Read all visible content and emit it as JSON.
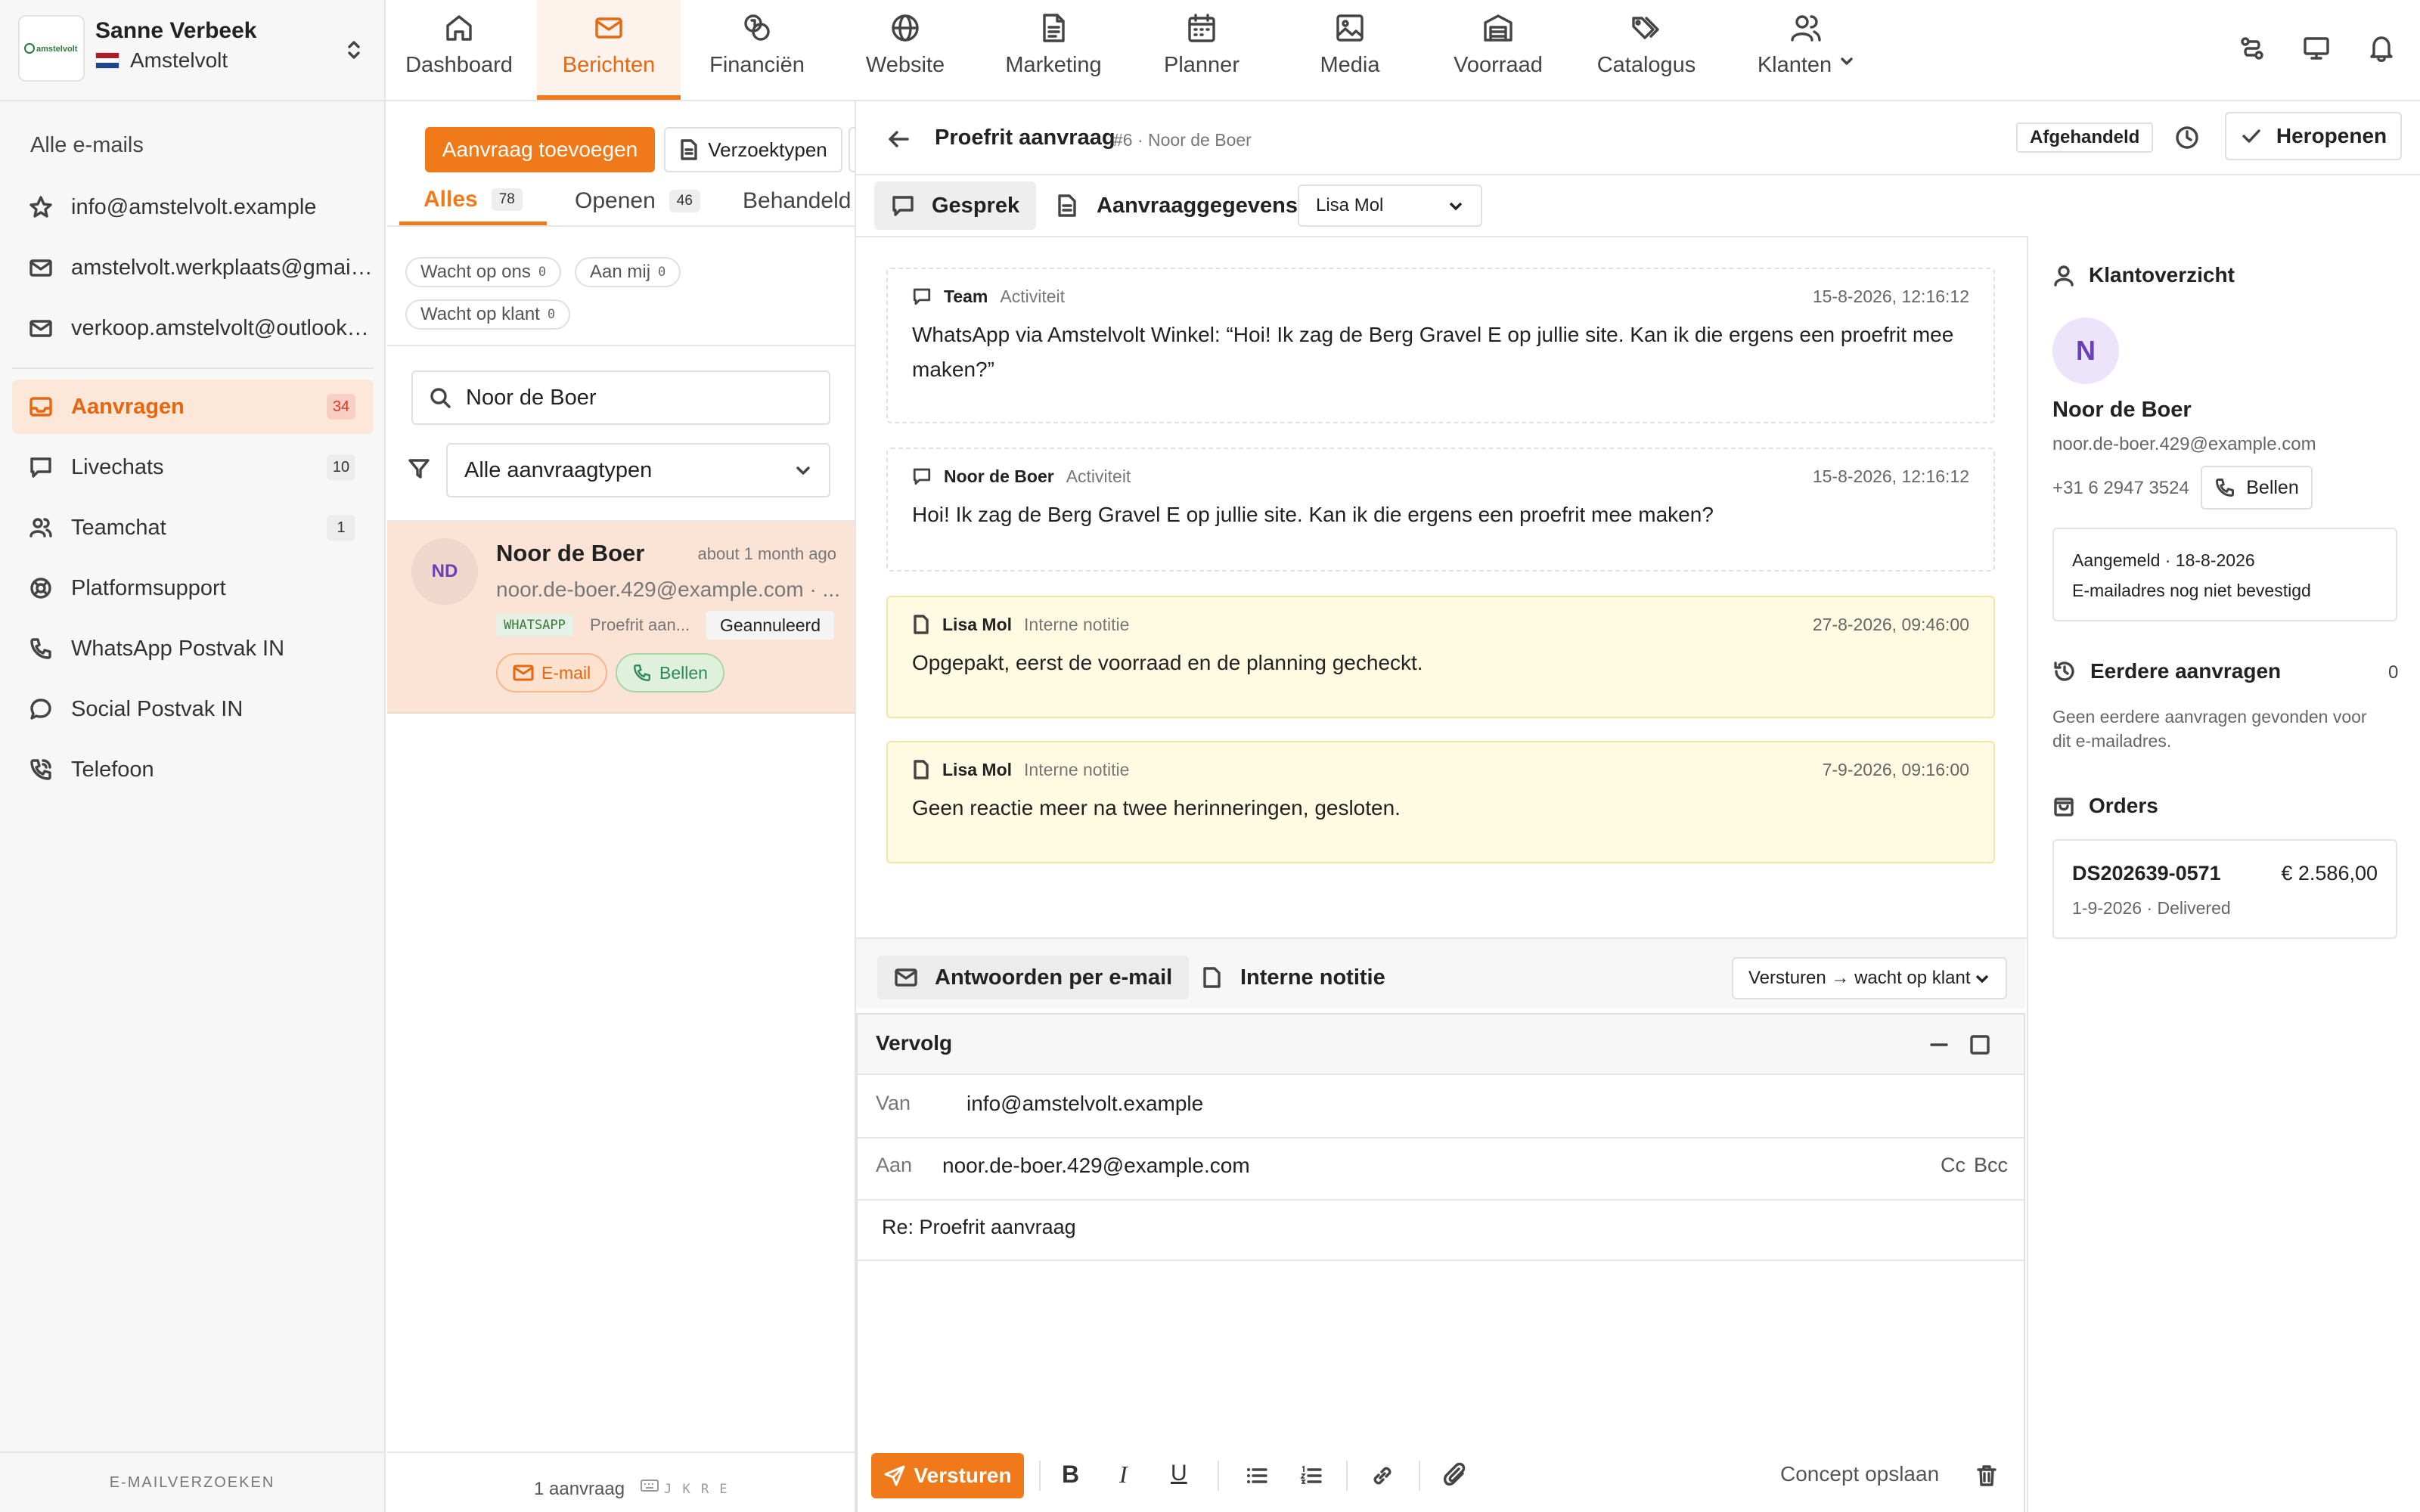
{
  "account": {
    "name": "Sanne Verbeek",
    "location": "Amstelvolt",
    "logo_text": "amstelvolt"
  },
  "nav": [
    {
      "label": "Dashboard",
      "icon": "home-icon"
    },
    {
      "label": "Berichten",
      "icon": "mail-icon",
      "active": true
    },
    {
      "label": "Financiën",
      "icon": "coins-icon"
    },
    {
      "label": "Website",
      "icon": "globe-icon"
    },
    {
      "label": "Marketing",
      "icon": "document-icon"
    },
    {
      "label": "Planner",
      "icon": "calendar-icon"
    },
    {
      "label": "Media",
      "icon": "image-icon"
    },
    {
      "label": "Voorraad",
      "icon": "warehouse-icon"
    },
    {
      "label": "Catalogus",
      "icon": "tags-icon"
    },
    {
      "label": "Klanten",
      "icon": "users-icon"
    }
  ],
  "sidebar": {
    "section": "Alle e-mails",
    "mailboxes": [
      "info@amstelvolt.example",
      "amstelvolt.werkplaats@gmail.com",
      "verkoop.amstelvolt@outlook.com"
    ],
    "items": [
      {
        "label": "Aanvragen",
        "count": "34",
        "active": true
      },
      {
        "label": "Livechats",
        "count": "10"
      },
      {
        "label": "Teamchat",
        "count": "1"
      },
      {
        "label": "Platformsupport",
        "count": ""
      },
      {
        "label": "WhatsApp Postvak IN",
        "count": ""
      },
      {
        "label": "Social Postvak IN",
        "count": ""
      },
      {
        "label": "Telefoon",
        "count": ""
      }
    ],
    "footer": "E-MAILVERZOEKEN"
  },
  "list": {
    "add_button": "Aanvraag toevoegen",
    "types_button": "Verzoektypen",
    "tabs": [
      {
        "label": "Alles",
        "count": "78",
        "active": true
      },
      {
        "label": "Openen",
        "count": "46"
      },
      {
        "label": "Behandeld",
        "count": ""
      }
    ],
    "chips": [
      {
        "label": "Wacht op ons",
        "count": "0"
      },
      {
        "label": "Aan mij",
        "count": "0"
      },
      {
        "label": "Wacht op klant",
        "count": "0"
      }
    ],
    "search_value": "Noor de Boer",
    "filter_value": "Alle aanvraagtypen",
    "card": {
      "initials": "ND",
      "name": "Noor de Boer",
      "time": "about 1 month ago",
      "email": "noor.de-boer.429@example.com · ...",
      "channel": "WHATSAPP",
      "subject": "Proefrit aan...",
      "status": "Geannuleerd",
      "email_button": "E-mail",
      "call_button": "Bellen"
    },
    "footer_count": "1 aanvraag",
    "footer_keys": "J K R E"
  },
  "conversation": {
    "title": "Proefrit aanvraag",
    "ref": "#6 · Noor de Boer",
    "status_badge": "Afgehandeld",
    "reopen_button": "Heropenen",
    "tab_conversation": "Gesprek",
    "tab_details": "Aanvraaggegevens",
    "assignee": "Lisa Mol",
    "messages": [
      {
        "who": "Team",
        "kind": "Activiteit",
        "time": "15-8-2026, 12:16:12",
        "text": "WhatsApp via Amstelvolt Winkel: “Hoi! Ik zag de Berg Gravel E op jullie site. Kan ik die ergens een proefrit mee maken?”"
      },
      {
        "who": "Noor de Boer",
        "kind": "Activiteit",
        "time": "15-8-2026, 12:16:12",
        "text": "Hoi! Ik zag de Berg Gravel E op jullie site. Kan ik die ergens een proefrit mee maken?"
      },
      {
        "who": "Lisa Mol",
        "kind": "Interne notitie",
        "time": "27-8-2026, 09:46:00",
        "text": "Opgepakt, eerst de voorraad en de planning gecheckt."
      },
      {
        "who": "Lisa Mol",
        "kind": "Interne notitie",
        "time": "7-9-2026, 09:16:00",
        "text": "Geen reactie meer na twee herinneringen, gesloten."
      }
    ]
  },
  "composer": {
    "reply_tab": "Antwoorden per e-mail",
    "note_tab": "Interne notitie",
    "send_mode": "Versturen → wacht op klant",
    "title": "Vervolg",
    "from_label": "Van",
    "from_value": "info@amstelvolt.example",
    "to_label": "Aan",
    "to_value": "noor.de-boer.429@example.com",
    "cc": "Cc",
    "bcc": "Bcc",
    "subject": "Re: Proefrit aanvraag",
    "send_button": "Versturen",
    "draft_button": "Concept opslaan"
  },
  "customer": {
    "heading": "Klantoverzicht",
    "initial": "N",
    "name": "Noor de Boer",
    "email": "noor.de-boer.429@example.com",
    "phone": "+31 6 2947 3524",
    "call_button": "Bellen",
    "registered": "Aangemeld · 18-8-2026",
    "email_status": "E-mailadres nog niet bevestigd",
    "previous_heading": "Eerdere aanvragen",
    "previous_count": "0",
    "previous_note": "Geen eerdere aanvragen gevonden voor dit e-mailadres.",
    "orders_heading": "Orders",
    "order": {
      "id": "DS202639-0571",
      "amount": "€ 2.586,00",
      "meta": "1-9-2026 · Delivered"
    }
  },
  "colors": {
    "accent": "#f07a1a",
    "active_bg": "#fde7d8",
    "note_bg": "#fffbe3",
    "call_green": "#2e8b57"
  }
}
